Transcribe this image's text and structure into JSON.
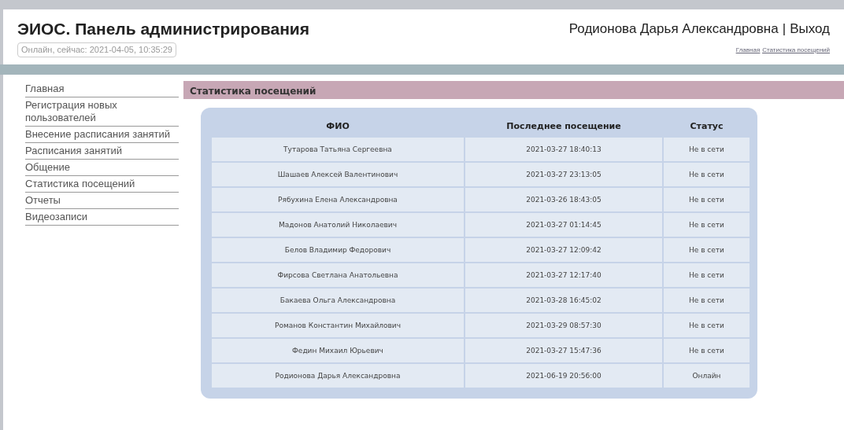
{
  "header": {
    "title": "ЭИОС. Панель администрирования",
    "status": "Онлайн, сейчас: 2021-04-05, 10:35:29",
    "user": "Родионова Дарья Александровна",
    "separator": "|",
    "logout": "Выход",
    "breadcrumbs": [
      "Главная",
      "Статистика посещений"
    ]
  },
  "sidebar": {
    "items": [
      "Главная",
      "Регистрация новых пользователей",
      "Внесение расписания занятий",
      "Расписания занятий",
      "Общение",
      "Статистика посещений",
      "Отчеты",
      "Видеозаписи"
    ]
  },
  "section_title": "Статистика посещений",
  "table": {
    "columns": [
      "ФИО",
      "Последнее посещение",
      "Статус"
    ],
    "rows": [
      [
        "Тутарова Татьяна Сергеевна",
        "2021-03-27 18:40:13",
        "Не в сети"
      ],
      [
        "Шашаев Алексей Валентинович",
        "2021-03-27 23:13:05",
        "Не в сети"
      ],
      [
        "Рябухина Елена Александровна",
        "2021-03-26 18:43:05",
        "Не в сети"
      ],
      [
        "Мадонов Анатолий Николаевич",
        "2021-03-27 01:14:45",
        "Не в сети"
      ],
      [
        "Белов Владимир Федорович",
        "2021-03-27 12:09:42",
        "Не в сети"
      ],
      [
        "Фирсова Светлана Анатольевна",
        "2021-03-27 12:17:40",
        "Не в сети"
      ],
      [
        "Бакаева Ольга Александровна",
        "2021-03-28 16:45:02",
        "Не в сети"
      ],
      [
        "Романов Константин Михайлович",
        "2021-03-29 08:57:30",
        "Не в сети"
      ],
      [
        "Федин Михаил Юрьевич",
        "2021-03-27 15:47:36",
        "Не в сети"
      ],
      [
        "Родионова Дарья Александровна",
        "2021-06-19 20:56:00",
        "Онлайн"
      ]
    ]
  }
}
